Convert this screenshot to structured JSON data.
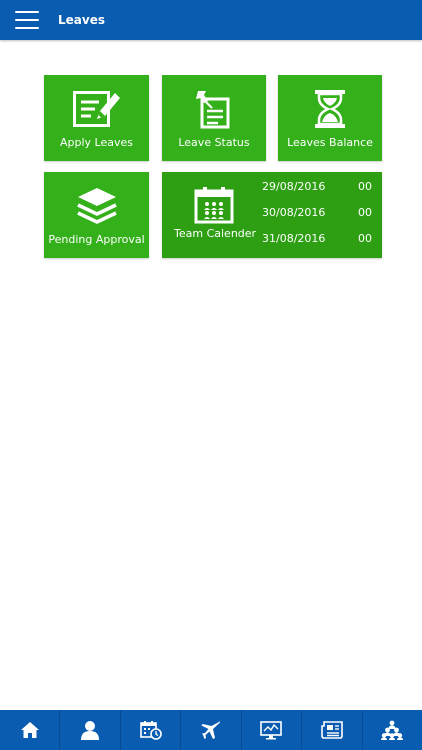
{
  "header": {
    "title": "Leaves",
    "menu_icon": "hamburger-menu-icon"
  },
  "colors": {
    "header_bg": "#0a5cb0",
    "tile_green": "#34b01a",
    "tile_dark_green": "#2e9f13",
    "text_white": "#ffffff"
  },
  "tiles": {
    "apply": {
      "label": "Apply Leaves",
      "icon": "edit-note-icon"
    },
    "status": {
      "label": "Leave Status",
      "icon": "pinned-note-icon"
    },
    "balance": {
      "label": "Leaves Balance",
      "icon": "hourglass-icon"
    },
    "pending": {
      "label": "Pending Approval",
      "icon": "stacked-layers-icon"
    },
    "team": {
      "label": "Team Calender",
      "icon": "team-calendar-icon",
      "rows": [
        {
          "date": "29/08/2016",
          "count": "00"
        },
        {
          "date": "30/08/2016",
          "count": "00"
        },
        {
          "date": "31/08/2016",
          "count": "00"
        }
      ]
    }
  },
  "bottom_nav": {
    "items": [
      {
        "name": "home",
        "icon": "home-icon"
      },
      {
        "name": "profile",
        "icon": "user-icon"
      },
      {
        "name": "calendar",
        "icon": "calendar-clock-icon"
      },
      {
        "name": "travel",
        "icon": "airplane-icon"
      },
      {
        "name": "performance",
        "icon": "monitor-chart-icon"
      },
      {
        "name": "news",
        "icon": "newspaper-icon"
      },
      {
        "name": "hierarchy",
        "icon": "people-hierarchy-icon"
      }
    ]
  }
}
